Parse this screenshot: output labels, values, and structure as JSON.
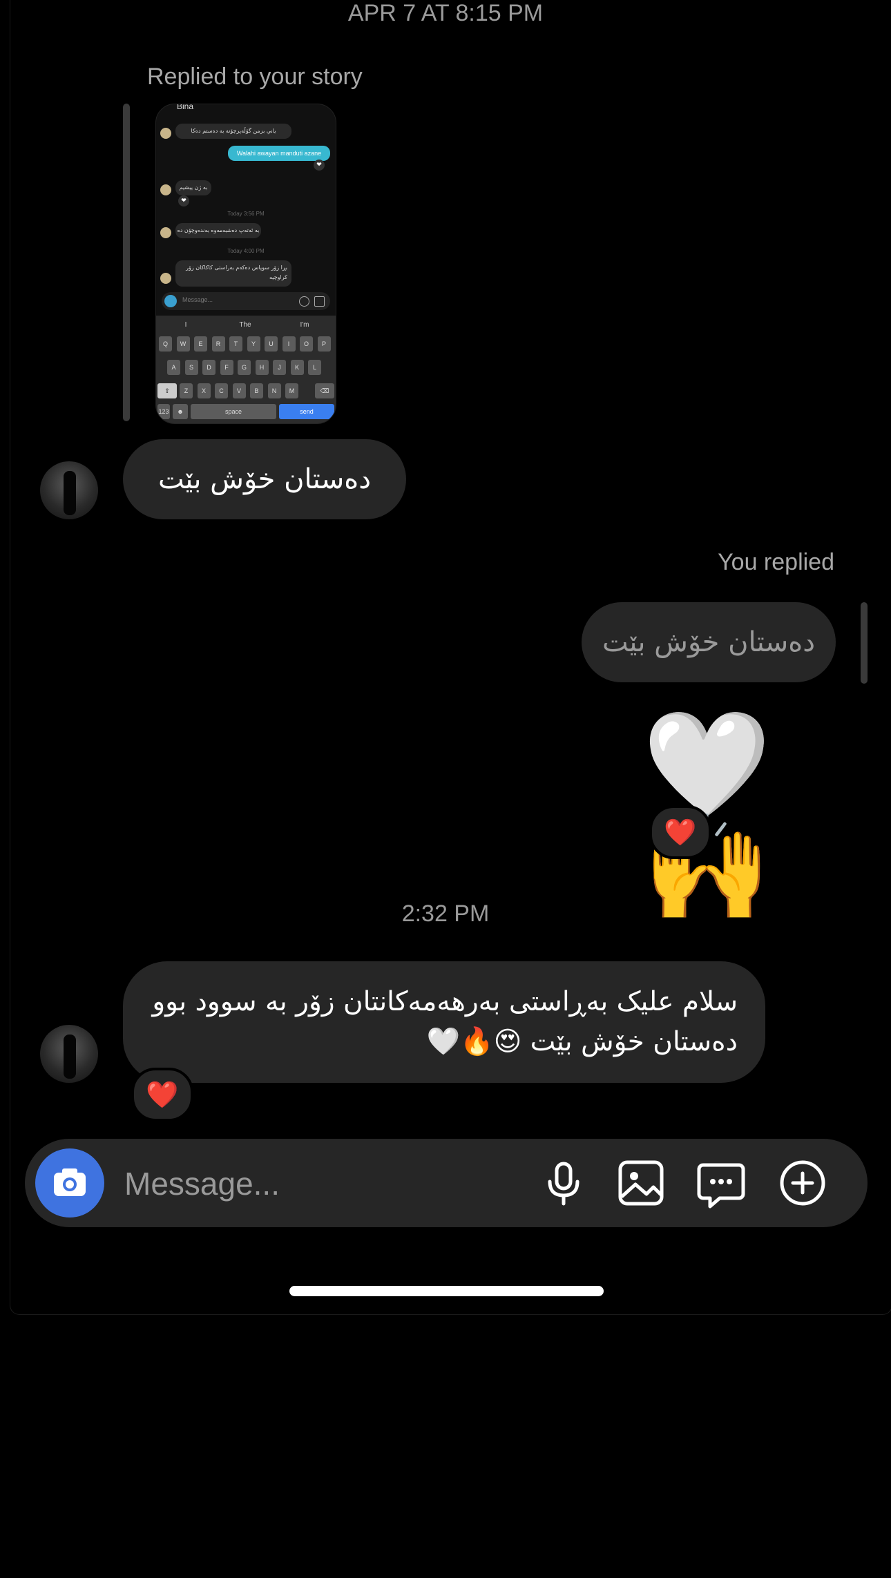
{
  "timestamps": {
    "first": "APR 7 AT 8:15 PM",
    "second": "2:32 PM"
  },
  "story_reply": {
    "label": "Replied to your story",
    "thumbnail": {
      "header_name": "Bina",
      "messages": [
        "ياني بزمن گۆڵەپرچۆنە بە دەستم دەکا",
        "Walahi awayan manduti azane",
        "بە ژن ییشیم"
      ],
      "times": [
        "Today 3:56 PM",
        "Today 4:00 PM"
      ],
      "later_messages": [
        "بە ئەتەپ دەشبەمەوە بەندەوچۆن دە رۆ",
        "بڕا زۆر سوپاس دەکەم بەراستی کاکاکان زۆر کراوچیە"
      ],
      "input_placeholder": "Message...",
      "suggestions": [
        "I",
        "The",
        "I'm"
      ],
      "keyboard_rows": [
        [
          "Q",
          "W",
          "E",
          "R",
          "T",
          "Y",
          "U",
          "I",
          "O",
          "P"
        ],
        [
          "A",
          "S",
          "D",
          "F",
          "G",
          "H",
          "J",
          "K",
          "L"
        ],
        [
          "Z",
          "X",
          "C",
          "V",
          "B",
          "N",
          "M"
        ]
      ],
      "space_label": "space",
      "send_label": "send"
    },
    "message": "دەستان خۆش بێت"
  },
  "you_replied": {
    "label": "You replied",
    "quoted": "دەستان خۆش بێت",
    "emojis": "🤍🙌",
    "reaction": "❤️"
  },
  "incoming_message": {
    "text": "سلام علیک بەڕاستی بەرهەمەکانتان زۆر بە سوود بوو دەستان خۆش بێت 😍🔥🤍",
    "reaction": "❤️"
  },
  "composer": {
    "placeholder": "Message...",
    "icons": [
      "camera-icon",
      "microphone-icon",
      "gallery-icon",
      "sticker-icon",
      "plus-icon"
    ]
  },
  "colors": {
    "accent": "#3f73e0",
    "bubble": "#262626",
    "background": "#000000"
  }
}
